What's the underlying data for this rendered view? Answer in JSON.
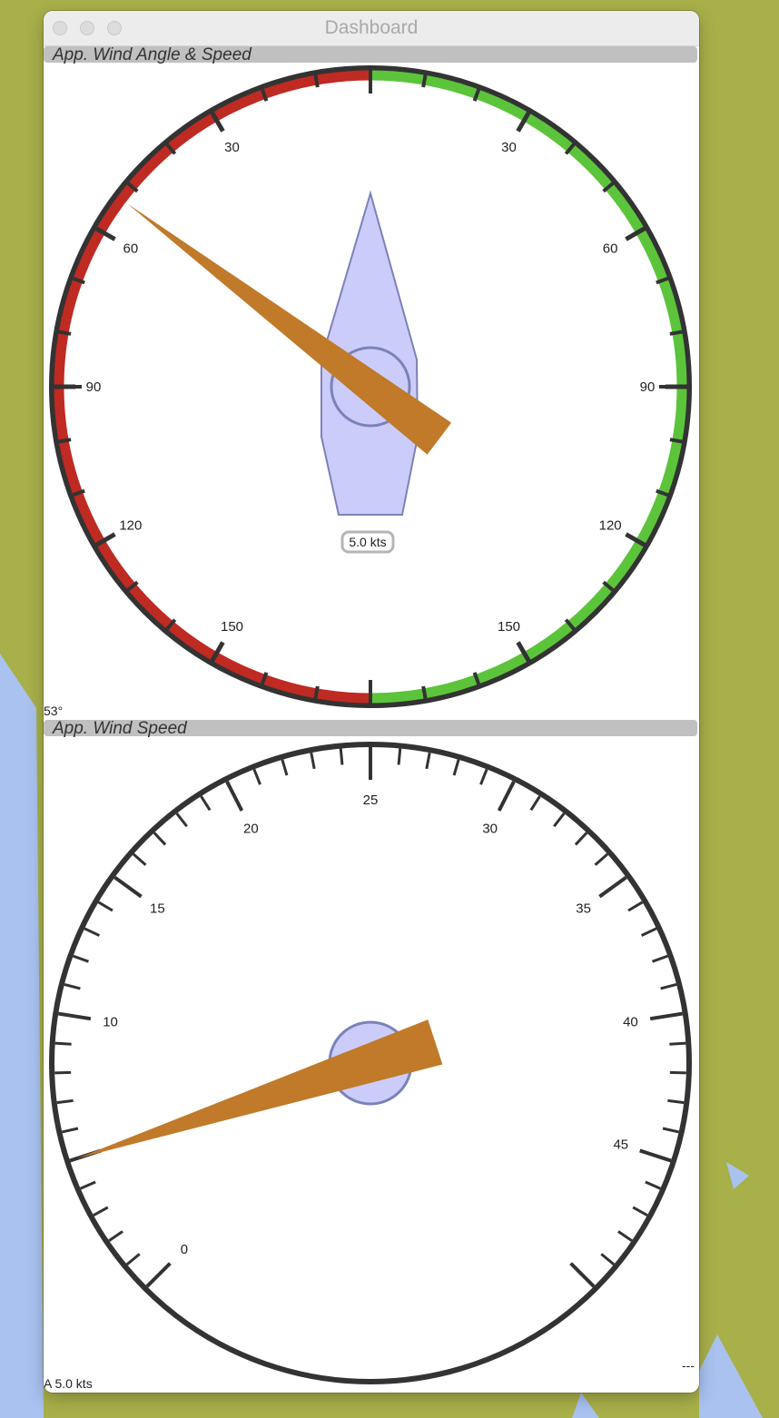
{
  "window": {
    "title": "Dashboard"
  },
  "wind_angle_panel": {
    "header": "App. Wind Angle & Speed",
    "port_scale_labels": [
      "30",
      "60",
      "90",
      "120",
      "150"
    ],
    "starboard_scale_labels": [
      "30",
      "60",
      "90",
      "120",
      "150"
    ],
    "speed_readout": "5.0 kts",
    "angle_readout": "53°",
    "needle_angle_deg": -53,
    "port_color": "#bf2a22",
    "starboard_color": "#5cc43a"
  },
  "wind_speed_panel": {
    "header": "App. Wind Speed",
    "scale_labels": [
      "0",
      "10",
      "15",
      "20",
      "25",
      "30",
      "35",
      "40",
      "45"
    ],
    "bottom_left_readout": "A 5.0 kts",
    "bottom_right_readout": "---",
    "needle_value": 5.0
  },
  "colors": {
    "needle": "#c07a2a",
    "boat_fill": "#ccccfa",
    "boat_stroke": "#7a82b8",
    "dial": "#333333"
  }
}
